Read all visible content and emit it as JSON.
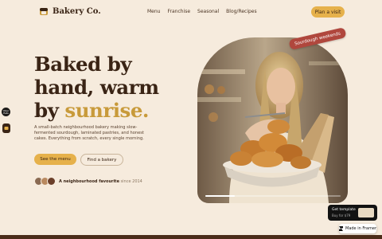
{
  "nav": {
    "brand": "Bakery Co.",
    "items": [
      "Menu",
      "Franchise",
      "Seasonal",
      "Blog/Recipes"
    ],
    "cta": "Plan a visit"
  },
  "hero": {
    "headline_1": "Baked by",
    "headline_2": "hand, warm",
    "headline_3a": "by ",
    "headline_3b": "sunrise.",
    "subtext": "A small-batch neighbourhood bakery making slow-fermented sourdough, laminated pastries, and honest cakes. Everything from scratch, every single morning.",
    "primary_cta": "See the menu",
    "secondary_cta": "Find a bakery",
    "social_bold": "A neighbourhood favourite",
    "social_muted": " since 2014",
    "tag": "Sourdough weekends",
    "progress": 0.22
  },
  "side_badge": "Uber Eats",
  "template_card": {
    "title": "Get template",
    "price": "Buy for $79"
  },
  "framer_badge": "Made in Framer",
  "colors": {
    "background": "#f6ebdd",
    "text": "#3a2415",
    "accent": "#c89a3a",
    "button": "#e6b14b",
    "tag": "#b0473d",
    "footer": "#4b2c19"
  }
}
